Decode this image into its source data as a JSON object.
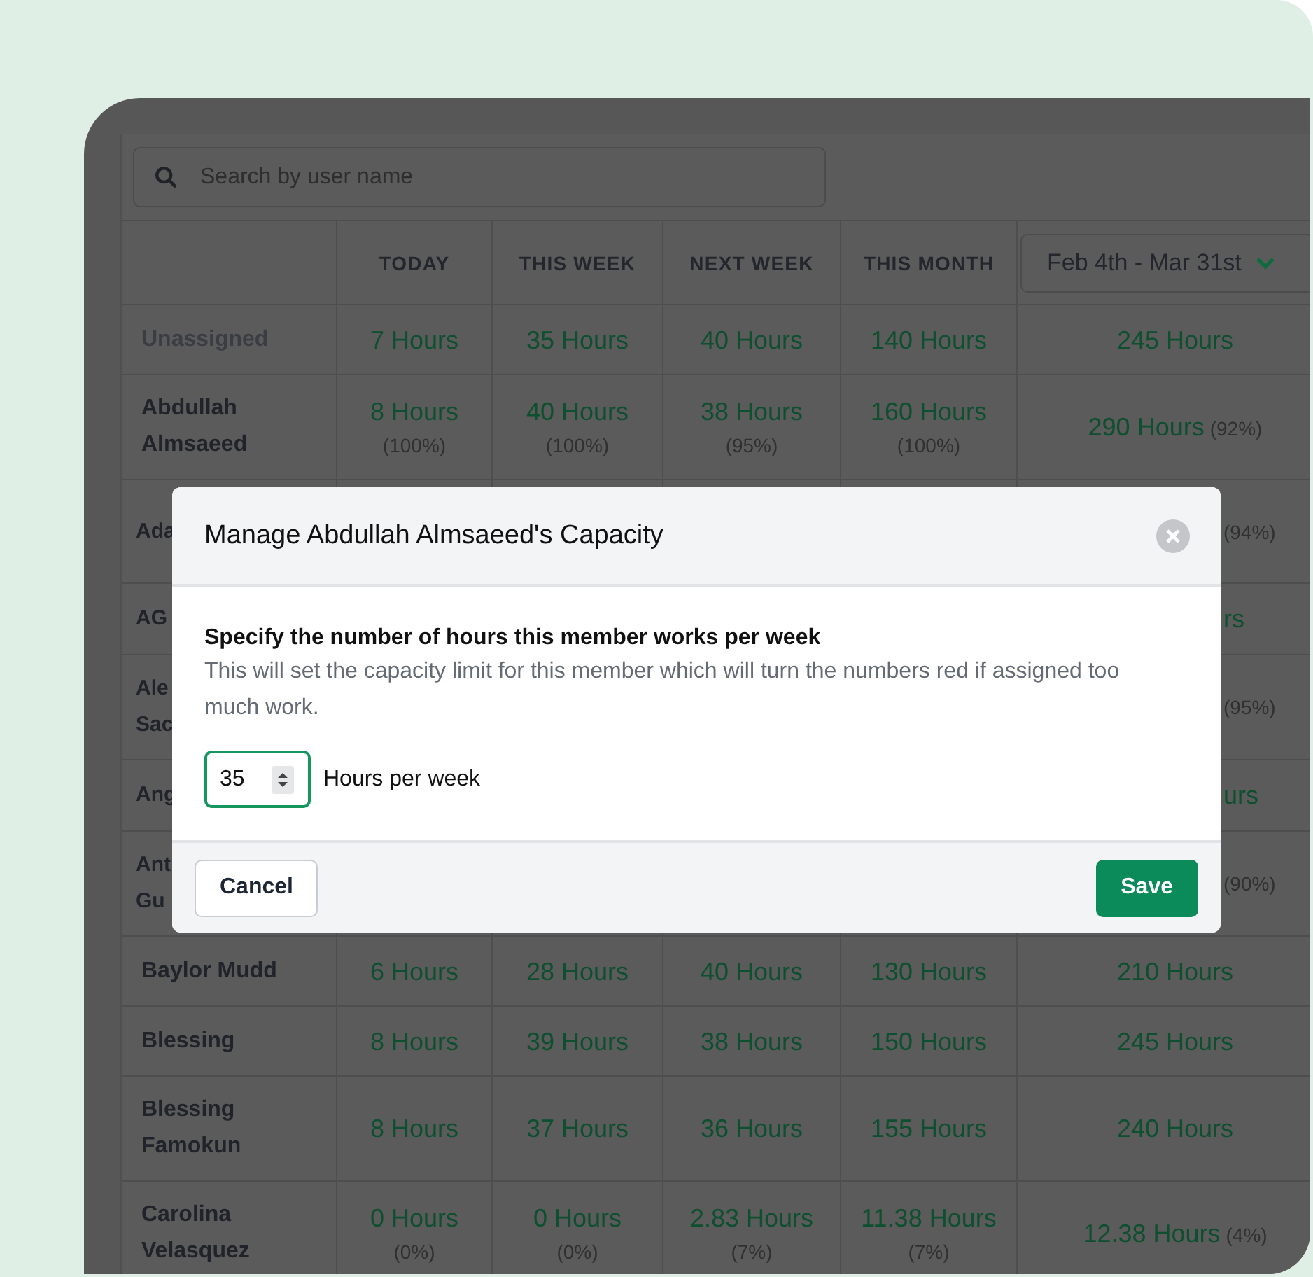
{
  "search": {
    "placeholder": "Search by user name"
  },
  "columns": [
    "TODAY",
    "THIS WEEK",
    "NEXT WEEK",
    "THIS MONTH"
  ],
  "date_range": {
    "label": "Feb 4th - Mar 31st"
  },
  "rows": [
    {
      "kind": "full",
      "name": "Unassigned",
      "muted": true,
      "cells": [
        {
          "hours": "7 Hours"
        },
        {
          "hours": "35 Hours"
        },
        {
          "hours": "40 Hours"
        },
        {
          "hours": "140 Hours"
        }
      ],
      "total": {
        "hours": "245 Hours"
      }
    },
    {
      "kind": "full",
      "name": "Abdullah Almsaeed",
      "muted": false,
      "cells": [
        {
          "hours": "8 Hours",
          "pct": "(100%)"
        },
        {
          "hours": "40 Hours",
          "pct": "(100%)"
        },
        {
          "hours": "38 Hours",
          "pct": "(95%)"
        },
        {
          "hours": "160 Hours",
          "pct": "(100%)"
        }
      ],
      "total": {
        "hours": "290 Hours",
        "pct": "(92%)"
      }
    },
    {
      "kind": "covered_pct",
      "name": "Ada",
      "muted": false,
      "tail": "(94%)"
    },
    {
      "kind": "covered_hours",
      "name": "AG",
      "muted": false,
      "tail": "rs"
    },
    {
      "kind": "covered_pct",
      "name": "Ale Sac",
      "muted": false,
      "tail": "(95%)"
    },
    {
      "kind": "covered_hours",
      "name": "Ang",
      "muted": false,
      "tail": "urs"
    },
    {
      "kind": "covered_pct",
      "name": "Ant Gu",
      "muted": false,
      "tail": "(90%)"
    },
    {
      "kind": "full",
      "name": "Baylor Mudd",
      "muted": false,
      "cells": [
        {
          "hours": "6 Hours"
        },
        {
          "hours": "28 Hours"
        },
        {
          "hours": "40 Hours"
        },
        {
          "hours": "130 Hours"
        }
      ],
      "total": {
        "hours": "210 Hours"
      }
    },
    {
      "kind": "full",
      "name": "Blessing",
      "muted": false,
      "cells": [
        {
          "hours": "8 Hours"
        },
        {
          "hours": "39 Hours"
        },
        {
          "hours": "38 Hours"
        },
        {
          "hours": "150 Hours"
        }
      ],
      "total": {
        "hours": "245 Hours"
      }
    },
    {
      "kind": "full",
      "name": "Blessing Famokun",
      "muted": false,
      "cells": [
        {
          "hours": "8 Hours"
        },
        {
          "hours": "37 Hours"
        },
        {
          "hours": "36 Hours"
        },
        {
          "hours": "155 Hours"
        }
      ],
      "total": {
        "hours": "240 Hours"
      }
    },
    {
      "kind": "full",
      "name": "Carolina Velasquez",
      "muted": false,
      "cells": [
        {
          "hours": "0 Hours",
          "pct": "(0%)"
        },
        {
          "hours": "0 Hours",
          "pct": "(0%)"
        },
        {
          "hours": "2.83 Hours",
          "pct": "(7%)"
        },
        {
          "hours": "11.38 Hours",
          "pct": "(7%)"
        }
      ],
      "total": {
        "hours": "12.38 Hours",
        "pct": "(4%)"
      }
    }
  ],
  "modal": {
    "title": "Manage Abdullah Almsaeed's Capacity",
    "heading": "Specify the number of hours this member works per week",
    "description": "This will set the capacity limit for this member which will turn the numbers red if assigned too much work.",
    "input": {
      "value": "35"
    },
    "input_label": "Hours per week",
    "buttons": [
      {
        "kind": "secondary",
        "label": "Cancel"
      },
      {
        "kind": "primary",
        "label": "Save"
      }
    ]
  }
}
